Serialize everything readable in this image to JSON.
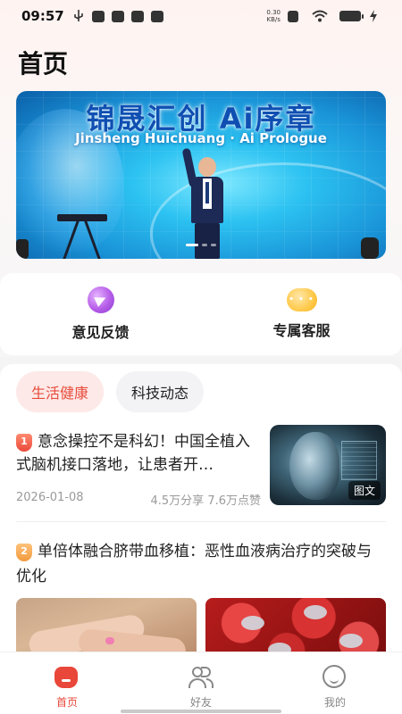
{
  "status_bar": {
    "time": "09:57",
    "net_speed_value": "0.30",
    "net_speed_unit": "KB/s",
    "left_icons": [
      "usb-icon",
      "notification-icon",
      "shield-icon",
      "app-icon",
      "app-icon"
    ],
    "right_icons": [
      "sim-icon",
      "wifi-icon",
      "battery-icon",
      "charging-icon"
    ]
  },
  "page": {
    "title": "首页"
  },
  "banner": {
    "title": "锦晟汇创 Ai序章",
    "subtitle": "Jinsheng Huichuang · Ai Prologue",
    "slide_count": 3,
    "active_slide": 1
  },
  "quick_actions": [
    {
      "label": "意见反馈",
      "icon": "paper-plane-icon",
      "color": "#b55ce8"
    },
    {
      "label": "专属客服",
      "icon": "chat-bubble-icon",
      "color": "#ffc94a"
    }
  ],
  "tabs": [
    {
      "label": "生活健康",
      "active": true
    },
    {
      "label": "科技动态",
      "active": false
    }
  ],
  "articles": [
    {
      "rank": "1",
      "title": "意念操控不是科幻！中国全植入式脑机接口落地，让患者开…",
      "date": "2026-01-08",
      "shares": "4.5万分享",
      "likes": "7.6万点赞",
      "thumb_tag": "图文"
    },
    {
      "rank": "2",
      "title": "单倍体融合脐带血移植：恶性血液病治疗的突破与优化"
    }
  ],
  "bottom_nav": [
    {
      "label": "首页",
      "icon": "home-icon",
      "active": true
    },
    {
      "label": "好友",
      "icon": "friends-icon",
      "active": false
    },
    {
      "label": "我的",
      "icon": "profile-icon",
      "active": false
    }
  ],
  "colors": {
    "accent": "#e8473a",
    "chip_active_bg": "#fde9e7",
    "banner_blue": "#2cc2f1"
  }
}
